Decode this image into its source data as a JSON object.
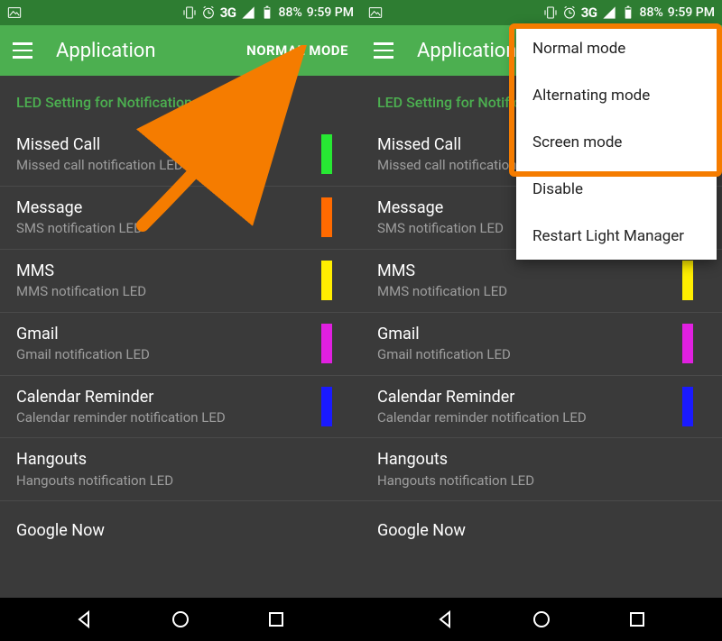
{
  "statusbar": {
    "network": "3G",
    "battery": "88%",
    "time": "9:59 PM"
  },
  "app": {
    "title": "Application",
    "mode": "NORMAL MODE",
    "section_header": "LED Setting for Notification"
  },
  "rows": [
    {
      "title": "Missed Call",
      "sub": "Missed call notification LED",
      "color": "#27e833"
    },
    {
      "title": "Message",
      "sub": "SMS notification LED",
      "color": "#ff6a00"
    },
    {
      "title": "MMS",
      "sub": "MMS notification LED",
      "color": "#ffee00"
    },
    {
      "title": "Gmail",
      "sub": "Gmail notification LED",
      "color": "#e020e0"
    },
    {
      "title": "Calendar Reminder",
      "sub": "Calendar reminder notification LED",
      "color": "#1a1aff"
    },
    {
      "title": "Hangouts",
      "sub": "Hangouts notification LED",
      "color": ""
    },
    {
      "title": "Google Now",
      "sub": "",
      "color": ""
    }
  ],
  "menu": {
    "items": [
      "Normal mode",
      "Alternating mode",
      "Screen mode",
      "Disable",
      "Restart Light Manager"
    ]
  }
}
